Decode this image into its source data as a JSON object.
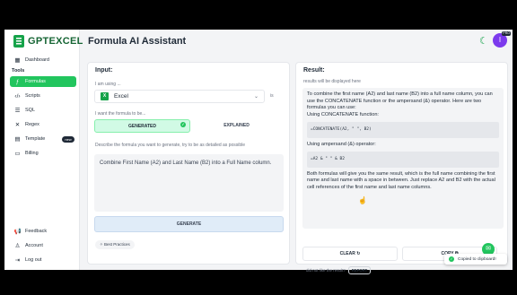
{
  "app": {
    "logo_text": "GPTEXCEL",
    "page_title": "Formula AI Assistant",
    "avatar_initial": "I",
    "avatar_badge": "PRO"
  },
  "sidebar": {
    "dashboard": "Dashboard",
    "tools_heading": "Tools",
    "tools": [
      {
        "label": "Formulas",
        "icon": "function-icon"
      },
      {
        "label": "Scripts",
        "icon": "code-icon"
      },
      {
        "label": "SQL",
        "icon": "database-icon"
      },
      {
        "label": "Regex",
        "icon": "regex-icon"
      },
      {
        "label": "Template",
        "icon": "table-icon",
        "badge": "new"
      },
      {
        "label": "Billing",
        "icon": "card-icon"
      }
    ],
    "bottom": [
      {
        "label": "Feedback",
        "icon": "megaphone-icon"
      },
      {
        "label": "Account",
        "icon": "user-icon"
      },
      {
        "label": "Log out",
        "icon": "logout-icon"
      }
    ]
  },
  "input": {
    "heading": "Input:",
    "using_label": "I am using ...",
    "app_selected": "Excel",
    "is_label": "is",
    "want_label": "I want the formula to be...",
    "mode_generated": "GENERATED",
    "mode_explained": "EXPLAINED",
    "describe_label": "Describe the formula you want to generate, try to be as detailed as possible",
    "prompt_text": "Combine First Name (A2) and Last Name (B2) into a Full Name column.",
    "generate_label": "GENERATE",
    "best_practices": "Best Practices"
  },
  "result": {
    "heading": "Result:",
    "hint": "results will be displayed here",
    "intro": "To combine the first name (A2) and last name (B2) into a full name column, you can use the CONCATENATE function or the ampersand (&) operator. Here are two formulas you can use:",
    "using_concat": "Using CONCATENATE function:",
    "formula1": "=CONCATENATE(A2, \" \", B2)",
    "using_amp": "Using ampersand (&) operator:",
    "formula2": "=A2 & \" \" & B2",
    "outro": "Both formulas will give you the same result, which is the full name combining the first name and last name with a space in between. Just replace A2 and B2 with the actual cell references of the first name and last name columns.",
    "clear_label": "CLEAR",
    "copy_label": "COPY",
    "feedback_q": "did not like the result?",
    "report_label": "REPORT"
  },
  "toast": {
    "message": "Copied to clipboard!"
  },
  "colors": {
    "accent": "#22c55e",
    "brand": "#166534",
    "avatar": "#7c3aed"
  }
}
